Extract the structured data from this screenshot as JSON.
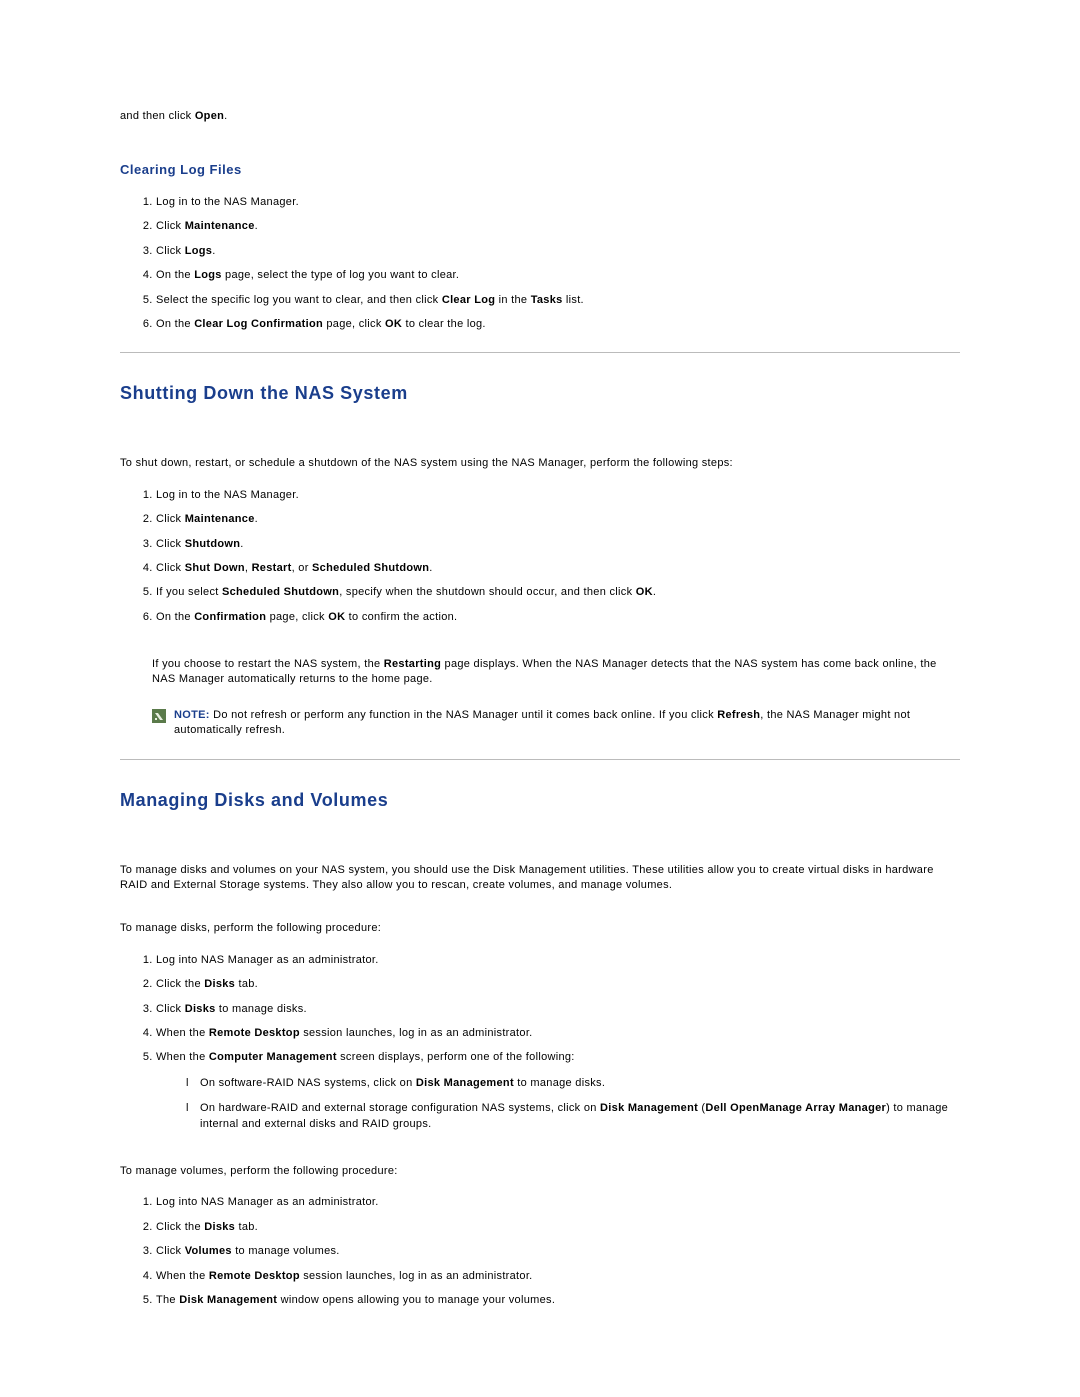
{
  "fragment_prefix": "and then click ",
  "fragment_bold": "Open",
  "fragment_suffix": ".",
  "sub_heading_1": "Clearing Log Files",
  "list1": {
    "i1": "Log in to the NAS Manager.",
    "i2_a": "Click ",
    "i2_b": "Maintenance",
    "i2_c": ".",
    "i3_a": "Click ",
    "i3_b": "Logs",
    "i3_c": ".",
    "i4_a": "On the ",
    "i4_b": "Logs",
    "i4_c": " page, select the type of log you want to clear.",
    "i5_a": "Select the specific log you want to clear, and then click ",
    "i5_b": "Clear Log",
    "i5_c": " in the ",
    "i5_d": "Tasks",
    "i5_e": " list.",
    "i6_a": "On the ",
    "i6_b": "Clear Log Confirmation",
    "i6_c": " page, click ",
    "i6_d": "OK",
    "i6_e": " to clear the log."
  },
  "section_2": "Shutting Down the NAS System",
  "p_shutdown_intro": "To shut down, restart, or schedule a shutdown of the NAS system using the NAS Manager, perform the following steps:",
  "list2": {
    "i1": "Log in to the NAS Manager.",
    "i2_a": "Click ",
    "i2_b": "Maintenance",
    "i2_c": ".",
    "i3_a": "Click ",
    "i3_b": "Shutdown",
    "i3_c": ".",
    "i4_a": "Click ",
    "i4_b": "Shut Down",
    "i4_c": ", ",
    "i4_d": "Restart",
    "i4_e": ", or ",
    "i4_f": "Scheduled Shutdown",
    "i4_g": ".",
    "i5_a": "If you select ",
    "i5_b": "Scheduled Shutdown",
    "i5_c": ", specify when the shutdown should occur, and then click ",
    "i5_d": "OK",
    "i5_e": ".",
    "i6_a": "On the ",
    "i6_b": "Confirmation",
    "i6_c": " page, click ",
    "i6_d": "OK",
    "i6_e": " to confirm the action."
  },
  "restart_note_a": "If you choose to restart the NAS system, the ",
  "restart_note_b": "Restarting",
  "restart_note_c": " page displays. When the NAS Manager detects that the NAS system has come back online, the NAS Manager automatically returns to the home page.",
  "note_label": "NOTE:",
  "note_body_a": " Do not refresh or perform any function in the NAS Manager until it comes back online. If you click ",
  "note_body_b": "Refresh",
  "note_body_c": ", the NAS Manager might not automatically refresh.",
  "section_3": "Managing Disks and Volumes",
  "p_mdv_intro": "To manage disks and volumes on your NAS system, you should use the Disk Management utilities. These utilities allow you to create virtual disks in hardware RAID and External Storage systems. They also allow you to rescan, create volumes, and manage volumes.",
  "p_manage_disks": "To manage disks, perform the following procedure:",
  "list3": {
    "i1": "Log into NAS Manager as an administrator.",
    "i2_a": "Click the ",
    "i2_b": "Disks",
    "i2_c": " tab.",
    "i3_a": "Click ",
    "i3_b": "Disks",
    "i3_c": " to manage disks.",
    "i4_a": "When the ",
    "i4_b": "Remote Desktop",
    "i4_c": " session launches, log in as an administrator.",
    "i5_a": "When the ",
    "i5_b": "Computer Management",
    "i5_c": " screen displays, perform one of the following:"
  },
  "sublist": {
    "s1_a": "On software-RAID NAS systems, click on ",
    "s1_b": "Disk Management",
    "s1_c": " to manage disks.",
    "s2_a": "On hardware-RAID and external storage configuration NAS systems, click on ",
    "s2_b": "Disk Management",
    "s2_c": " (",
    "s2_d": "Dell OpenManage Array Manager",
    "s2_e": ") to manage internal and external disks and RAID groups."
  },
  "p_manage_vols": "To manage volumes, perform the following procedure:",
  "list4": {
    "i1": "Log into NAS Manager as an administrator.",
    "i2_a": "Click the ",
    "i2_b": "Disks",
    "i2_c": " tab.",
    "i3_a": "Click ",
    "i3_b": "Volumes",
    "i3_c": " to manage volumes.",
    "i4_a": "When the ",
    "i4_b": "Remote Desktop",
    "i4_c": " session launches, log in as an administrator.",
    "i5_a": "The ",
    "i5_b": "Disk Management",
    "i5_c": " window opens allowing you to manage your volumes."
  }
}
